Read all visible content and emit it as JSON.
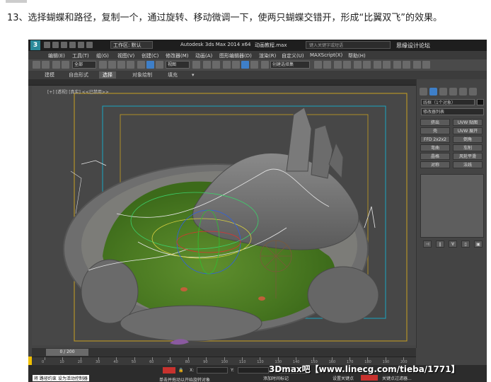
{
  "caption": "13、选择蝴蝶和路径，复制一个，通过旋转、移动微调一下，使两只蝴蝶交错开，形成“比翼双飞”的效果。",
  "titlebar": {
    "workspace": "工作区: 默认",
    "app_title": "Autodesk 3ds Max  2014 x64",
    "file_title": "动画教程.max",
    "search_placeholder": "键入关键字或短语",
    "watermark": "思缘设计论坛"
  },
  "menubar": {
    "items": [
      "编辑(E)",
      "工具(T)",
      "组(G)",
      "视图(V)",
      "创建(C)",
      "修改器(M)",
      "动画(A)",
      "图形编辑器(D)",
      "渲染(R)",
      "自定义(U)",
      "MAXScript(X)",
      "帮助(H)"
    ]
  },
  "toolbar": {
    "selection_filter": "全部",
    "ref_coord": "视图",
    "named_selection": "创建选择集"
  },
  "ribbon": {
    "tabs": [
      "建模",
      "自由形式",
      "选择",
      "对象绘制",
      "填充"
    ],
    "active_index": 2
  },
  "viewport": {
    "label": "[+] [透视] [真实] <<已禁用>>"
  },
  "command_panel": {
    "object_name": "线框（1个对象）",
    "modifier_list": "修改器列表",
    "modifier_buttons": [
      "挤出",
      "UVW 贴图",
      "壳",
      "UVW 展开",
      "FFD 2x2x2",
      "倒角",
      "弯曲",
      "车削",
      "晶格",
      "风轮平滑",
      "对称",
      "法线"
    ]
  },
  "timeslider": {
    "position": "0 / 200"
  },
  "trackbar": {
    "ticks": [
      "0",
      "10",
      "20",
      "30",
      "40",
      "50",
      "60",
      "70",
      "80",
      "90",
      "100",
      "110",
      "120",
      "130",
      "140",
      "150",
      "160",
      "170",
      "180",
      "190",
      "200"
    ]
  },
  "statusbar": {
    "selection_info": "将 路径约束 设为活动控制器",
    "prompt": "单击并拖动以开始旋转对象",
    "coord_x_label": "X:",
    "coord_y_label": "Y:",
    "coord_z_label": "Z:",
    "add_time_tag": "添加时间标记",
    "set_key": "设置关键点",
    "auto_key": "关键点过滤器..."
  },
  "overlay": {
    "text": "3Dmax吧【www.linecg.com/tieba/1771】"
  }
}
